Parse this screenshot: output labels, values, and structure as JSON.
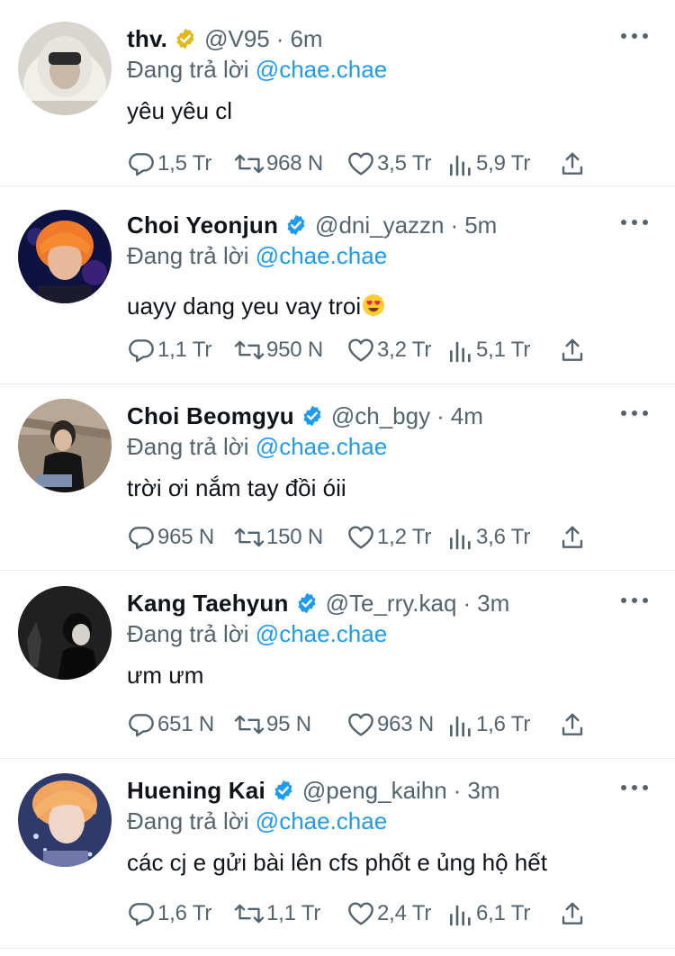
{
  "icons": {
    "reply": "reply-icon",
    "retweet": "retweet-icon",
    "like": "heart-icon",
    "views": "views-icon",
    "share": "share-icon",
    "verified": "verified-badge-icon",
    "more": "more-icon"
  },
  "colors": {
    "mention": "#1d9bf0",
    "muted": "#536471",
    "verified_blue": "#1d9bf0",
    "verified_gold": "#e2b719"
  },
  "tweets": [
    {
      "name": "thv.",
      "verified": "gold",
      "handle": "@V95",
      "dot": "·",
      "time": "6m",
      "reply_prefix": "Đang trả lời",
      "reply_mention": "@chae.chae",
      "text": "yêu yêu cl",
      "emoji": "",
      "replies": "1,5 Tr",
      "retweets": "968 N",
      "likes": "3,5 Tr",
      "views": "5,9 Tr"
    },
    {
      "name": "Choi Yeonjun",
      "verified": "blue",
      "handle": "@dni_yazzn",
      "dot": "·",
      "time": "5m",
      "reply_prefix": "Đang trả lời",
      "reply_mention": "@chae.chae",
      "text": "uayy dang yeu vay troi",
      "emoji": "heart-eyes",
      "replies": "1,1 Tr",
      "retweets": "950 N",
      "likes": "3,2 Tr",
      "views": "5,1 Tr"
    },
    {
      "name": "Choi Beomgyu",
      "verified": "blue",
      "handle": "@ch_bgy",
      "dot": "·",
      "time": "4m",
      "reply_prefix": "Đang trả lời",
      "reply_mention": "@chae.chae",
      "text": "trời ơi nắm tay đồi óii",
      "emoji": "",
      "replies": "965 N",
      "retweets": "150 N",
      "likes": "1,2 Tr",
      "views": "3,6 Tr"
    },
    {
      "name": "Kang Taehyun",
      "verified": "blue",
      "handle": "@Te_rry.kaq",
      "dot": "·",
      "time": "3m",
      "reply_prefix": "Đang trả lời",
      "reply_mention": "@chae.chae",
      "text": "ưm ưm",
      "emoji": "",
      "replies": "651 N",
      "retweets": "95 N",
      "likes": "963 N",
      "views": "1,6 Tr"
    },
    {
      "name": "Huening Kai",
      "verified": "blue",
      "handle": "@peng_kaihn",
      "dot": "·",
      "time": "3m",
      "reply_prefix": "Đang trả lời",
      "reply_mention": "@chae.chae",
      "text": "các cj e gửi bài lên cfs phốt e ủng hộ hết",
      "emoji": "",
      "replies": "1,6 Tr",
      "retweets": "1,1 Tr",
      "likes": "2,4 Tr",
      "views": "6,1 Tr"
    }
  ]
}
